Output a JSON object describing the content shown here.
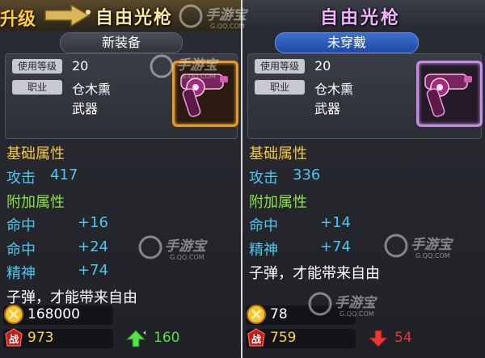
{
  "left": {
    "badge_text": "升级",
    "title": "自由光枪",
    "status": "新装备",
    "level_tag": "使用等级",
    "level_value": "20",
    "job_tag": "职业",
    "job_value": "仓木熏",
    "type_value": "武器",
    "base_attr_head": "基础属性",
    "attack_label": "攻击",
    "attack_value": "417",
    "extra_attr_head": "附加属性",
    "extras": [
      {
        "label": "命中",
        "value": "+16"
      },
      {
        "label": "命中",
        "value": "+24"
      },
      {
        "label": "精神",
        "value": "+74"
      }
    ],
    "description": "子弹，才能带来自由",
    "price": "168000",
    "power": "973",
    "delta": "160",
    "delta_color": "#57e04a",
    "frame_color": "#e99a1c"
  },
  "right": {
    "title": "自由光枪",
    "status": "未穿戴",
    "level_tag": "使用等级",
    "level_value": "20",
    "job_tag": "职业",
    "job_value": "仓木熏",
    "type_value": "武器",
    "base_attr_head": "基础属性",
    "attack_label": "攻击",
    "attack_value": "336",
    "extra_attr_head": "附加属性",
    "extras": [
      {
        "label": "命中",
        "value": "+14"
      },
      {
        "label": "精神",
        "value": "+74"
      }
    ],
    "description": "子弹，才能带来自由",
    "price": "78",
    "power": "759",
    "delta": "54",
    "delta_color": "#e83838",
    "frame_color": "#c58be8"
  },
  "watermark": {
    "brand": "手游宝",
    "domain": "G.QQ.COM"
  },
  "power_glyph": "战",
  "icons": {
    "coin": "coin-icon",
    "power": "power-badge-icon",
    "up": "arrow-up-icon",
    "down": "arrow-down-icon",
    "gun": "revolver-icon"
  }
}
